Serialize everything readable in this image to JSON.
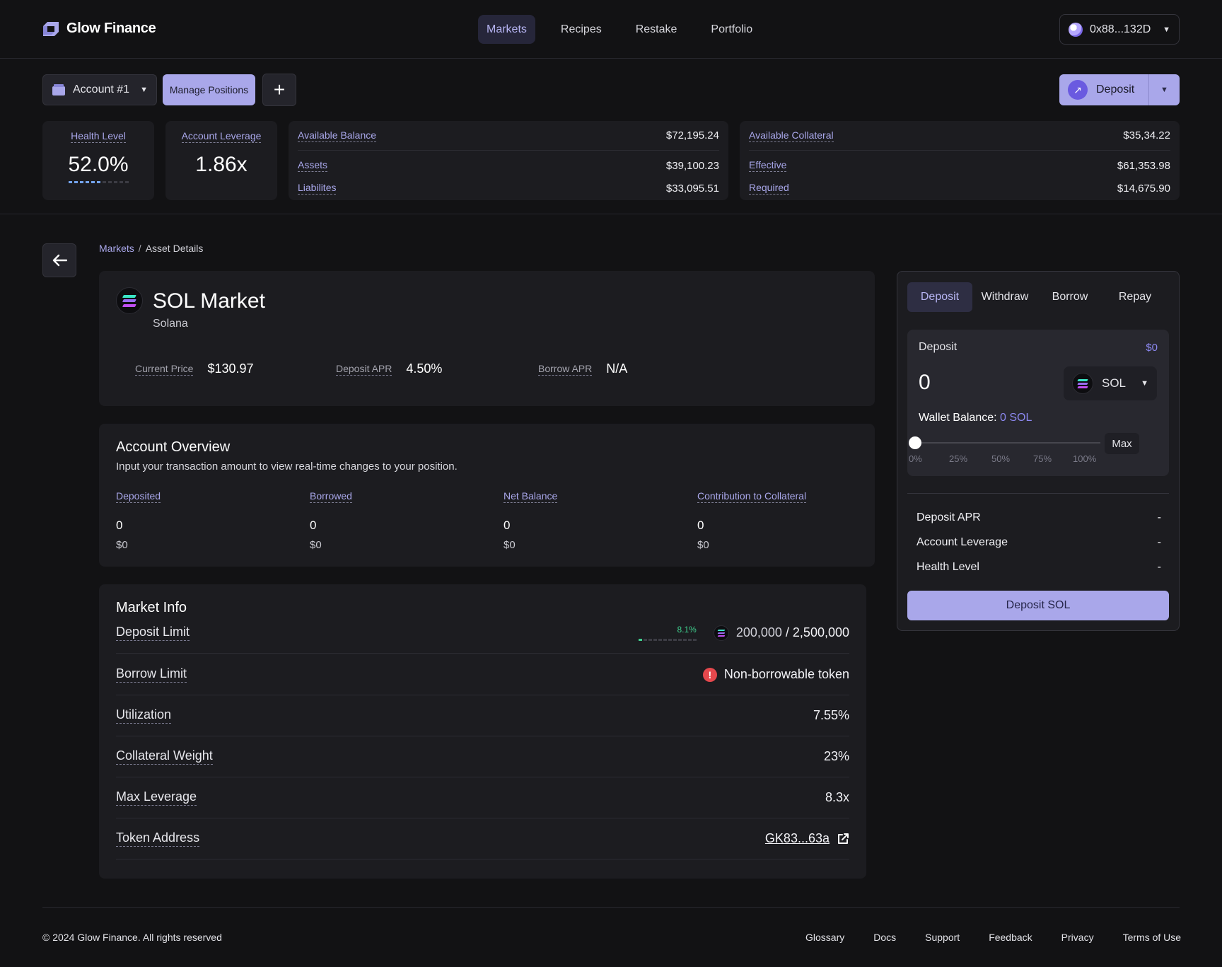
{
  "brand": {
    "name": "Glow Finance"
  },
  "nav": {
    "items": [
      "Markets",
      "Recipes",
      "Restake",
      "Portfolio"
    ],
    "active": "Markets"
  },
  "wallet": {
    "address": "0x88...132D"
  },
  "account": {
    "selector_label": "Account #1",
    "manage_label": "Manage Positions",
    "deposit_label": "Deposit"
  },
  "stats": {
    "health": {
      "label": "Health Level",
      "value": "52.0%",
      "fraction": 0.52
    },
    "leverage": {
      "label": "Account Leverage",
      "value": "1.86x"
    },
    "balance": {
      "available_label": "Available Balance",
      "available_value": "$72,195.24",
      "assets_label": "Assets",
      "assets_value": "$39,100.23",
      "liabilities_label": "Liabilites",
      "liabilities_value": "$33,095.51"
    },
    "collateral": {
      "available_label": "Available Collateral",
      "available_value": "$35,34.22",
      "effective_label": "Effective",
      "effective_value": "$61,353.98",
      "required_label": "Required",
      "required_value": "$14,675.90"
    }
  },
  "breadcrumb": {
    "root": "Markets",
    "sep": "/",
    "current": "Asset Details"
  },
  "market": {
    "title": "SOL Market",
    "subtitle": "Solana",
    "price_label": "Current Price",
    "price_value": "$130.97",
    "deposit_apr_label": "Deposit APR",
    "deposit_apr_value": "4.50%",
    "borrow_apr_label": "Borrow APR",
    "borrow_apr_value": "N/A"
  },
  "overview": {
    "title": "Account Overview",
    "subtitle": "Input your transaction amount to view real-time changes to your position.",
    "columns": [
      {
        "label": "Deposited",
        "amount": "0",
        "usd": "$0"
      },
      {
        "label": "Borrowed",
        "amount": "0",
        "usd": "$0"
      },
      {
        "label": "Net Balance",
        "amount": "0",
        "usd": "$0"
      },
      {
        "label": "Contribution to Collateral",
        "amount": "0",
        "usd": "$0"
      }
    ]
  },
  "market_info": {
    "title": "Market Info",
    "deposit_limit": {
      "label": "Deposit Limit",
      "percent": "8.1%",
      "fraction": 0.081,
      "current": "200,000",
      "sep": " / ",
      "max": "2,500,000"
    },
    "borrow_limit": {
      "label": "Borrow Limit",
      "value": "Non-borrowable token"
    },
    "utilization": {
      "label": "Utilization",
      "value": "7.55%"
    },
    "collateral_weight": {
      "label": "Collateral Weight",
      "value": "23%"
    },
    "max_leverage": {
      "label": "Max Leverage",
      "value": "8.3x"
    },
    "token_address": {
      "label": "Token Address",
      "value": "GK83...63a"
    }
  },
  "panel": {
    "tabs": [
      "Deposit",
      "Withdraw",
      "Borrow",
      "Repay"
    ],
    "active_tab": "Deposit",
    "input_label": "Deposit",
    "input_usd": "$0",
    "amount": "0",
    "token": "SOL",
    "wallet_balance_label": "Wallet Balance:",
    "wallet_balance_value": "0 SOL",
    "slider_value": 0,
    "slider_ticks": [
      "0%",
      "25%",
      "50%",
      "75%",
      "100%"
    ],
    "max_label": "Max",
    "summary": [
      {
        "label": "Deposit APR",
        "value": "-"
      },
      {
        "label": "Account Leverage",
        "value": "-"
      },
      {
        "label": "Health Level",
        "value": "-"
      }
    ],
    "submit_label": "Deposit SOL"
  },
  "footer": {
    "copyright": "© 2024 Glow Finance. All rights reserved",
    "links": [
      "Glossary",
      "Docs",
      "Support",
      "Feedback",
      "Privacy",
      "Terms of Use"
    ]
  },
  "colors": {
    "accent": "#a9a7ea",
    "background": "#121214",
    "card": "#1c1c20",
    "danger": "#e5484d",
    "success": "#3fcf8e"
  }
}
